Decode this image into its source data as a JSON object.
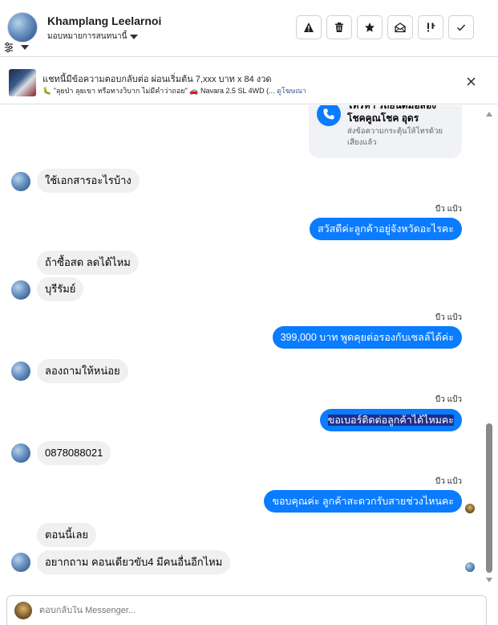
{
  "header": {
    "contact_name": "Khamplang Leelarnoi",
    "assign_label": "มอบหมายการสนทนานี้",
    "actions": [
      {
        "name": "report-spam",
        "icon": "warning-icon"
      },
      {
        "name": "delete",
        "icon": "trash-icon"
      },
      {
        "name": "star",
        "icon": "star-icon"
      },
      {
        "name": "mark-unread",
        "icon": "open-envelope-icon"
      },
      {
        "name": "mark-important",
        "icon": "exclamation-icon"
      },
      {
        "name": "mark-done",
        "icon": "check-icon"
      }
    ]
  },
  "ad_banner": {
    "title": "แชทนี้มีข้อความตอบกลับต่อ ผ่อนเริ่มต้น 7,xxx บาท x 84 งวด",
    "subtitle": "🐛 \"ลุยป่า ลุยเขา หรือทางวิบาก ไม่มีคำว่าถอย\" 🚗 Navara 2.5 SL 4WD (...",
    "link_text": "ดูโฆษณา"
  },
  "card": {
    "title": "โทรหา รถยนต์มือสอง โชคคูณโชค อุดร",
    "subtitle": "ส่งข้อความกระตุ้นให้โทรด้วยเสียงแล้ว"
  },
  "messages": [
    {
      "dir": "in",
      "text": "ใช้เอกสารอะไรบ้าง"
    },
    {
      "dir": "out",
      "sender": "บีว แป้ว",
      "text": "สวัสดีค่ะลูกค้าอยู่จังหวัดอะไรคะ"
    },
    {
      "dir": "in",
      "text": "ถ้าซื้อสด ลดได้ไหม"
    },
    {
      "dir": "in",
      "text": "บุรีรัมย์"
    },
    {
      "dir": "out",
      "sender": "บีว แป้ว",
      "text": "399,000 บาท  พูดคุยต่อรองกับเซลล์ได้ค่ะ"
    },
    {
      "dir": "in",
      "text": "ลองถามให้หน่อย"
    },
    {
      "dir": "out",
      "sender": "บีว แป้ว",
      "text": "ขอเบอร์ติดต่อลูกค้าได้ไหมคะ"
    },
    {
      "dir": "in",
      "text": "0878088021"
    },
    {
      "dir": "out",
      "sender": "บีว แป้ว",
      "text": "ขอบคุณค่ะ  ลูกค้าสะดวกรับสายช่วงไหนคะ"
    },
    {
      "dir": "in",
      "text": "ตอนนี้เลย"
    },
    {
      "dir": "in",
      "text": "อยากถาม คอนเดียวขับ4 มีคนอื่นอีกไหม"
    }
  ],
  "composer": {
    "placeholder": "ตอบกลับใน Messenger..."
  },
  "colors": {
    "outgoing_bubble": "#0a7cff",
    "incoming_bubble": "#f0f0f0"
  }
}
